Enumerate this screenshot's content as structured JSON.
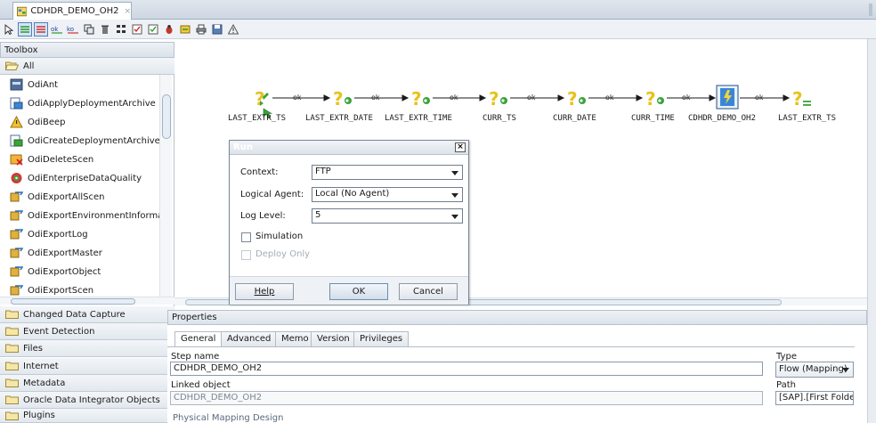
{
  "document_tab": {
    "title": "CDHDR_DEMO_OH2",
    "close_glyph": "×"
  },
  "toolbar": {
    "icons": [
      "select-icon",
      "free-choice-icon",
      "next-step-on-success-icon",
      "next-step-on-failure-icon",
      "ok-link-icon",
      "ko-link-icon",
      "duplicate-icon",
      "delete-icon",
      "layout-icon",
      "validate-icon",
      "execute-icon",
      "debug-icon",
      "step-icon",
      "print-icon",
      "save-diagram-icon",
      "warning-icon"
    ]
  },
  "toolbox": {
    "header": "Toolbox",
    "category_all": "All",
    "tools": [
      "OdiAnt",
      "OdiApplyDeploymentArchive",
      "OdiBeep",
      "OdiCreateDeploymentArchive",
      "OdiDeleteScen",
      "OdiEnterpriseDataQuality",
      "OdiExportAllScen",
      "OdiExportEnvironmentInformation",
      "OdiExportLog",
      "OdiExportMaster",
      "OdiExportObject",
      "OdiExportScen"
    ],
    "categories": [
      "Changed Data Capture",
      "Event Detection",
      "Files",
      "Internet",
      "Metadata",
      "Oracle Data Integrator Objects",
      "Plugins"
    ]
  },
  "diagram": {
    "steps": [
      "LAST_EXTR_TS",
      "LAST_EXTR_DATE",
      "LAST_EXTR_TIME",
      "CURR_TS",
      "CURR_DATE",
      "CURR_TIME",
      "CDHDR_DEMO_OH2",
      "LAST_EXTR_TS"
    ],
    "link_label": "ok",
    "colors": {
      "arrow": "#1a1a1a",
      "variable_yellow": "#e8c21a",
      "variable_green": "#3aa33a",
      "mapping_blue": "#3a86d6"
    }
  },
  "run_dialog": {
    "title": "Run",
    "close_glyph": "×",
    "context_label": "Context:",
    "context_value": "FTP",
    "agent_label": "Logical Agent:",
    "agent_value": "Local (No Agent)",
    "log_level_label": "Log Level:",
    "log_level_value": "5",
    "simulation_label": "Simulation",
    "deploy_only_label": "Deploy Only",
    "help_label": "Help",
    "ok_label": "OK",
    "cancel_label": "Cancel"
  },
  "properties": {
    "header": "Properties",
    "tabs": [
      "General",
      "Advanced",
      "Memo",
      "Version",
      "Privileges"
    ],
    "active_tab": "General",
    "step_name_label": "Step name",
    "step_name_value": "CDHDR_DEMO_OH2",
    "type_label": "Type",
    "type_value": "Flow (Mapping)",
    "linked_object_label": "Linked object",
    "linked_object_value": "CDHDR_DEMO_OH2",
    "path_label": "Path",
    "path_value": "[SAP].[First Folder]",
    "section_title": "Physical Mapping Design"
  }
}
